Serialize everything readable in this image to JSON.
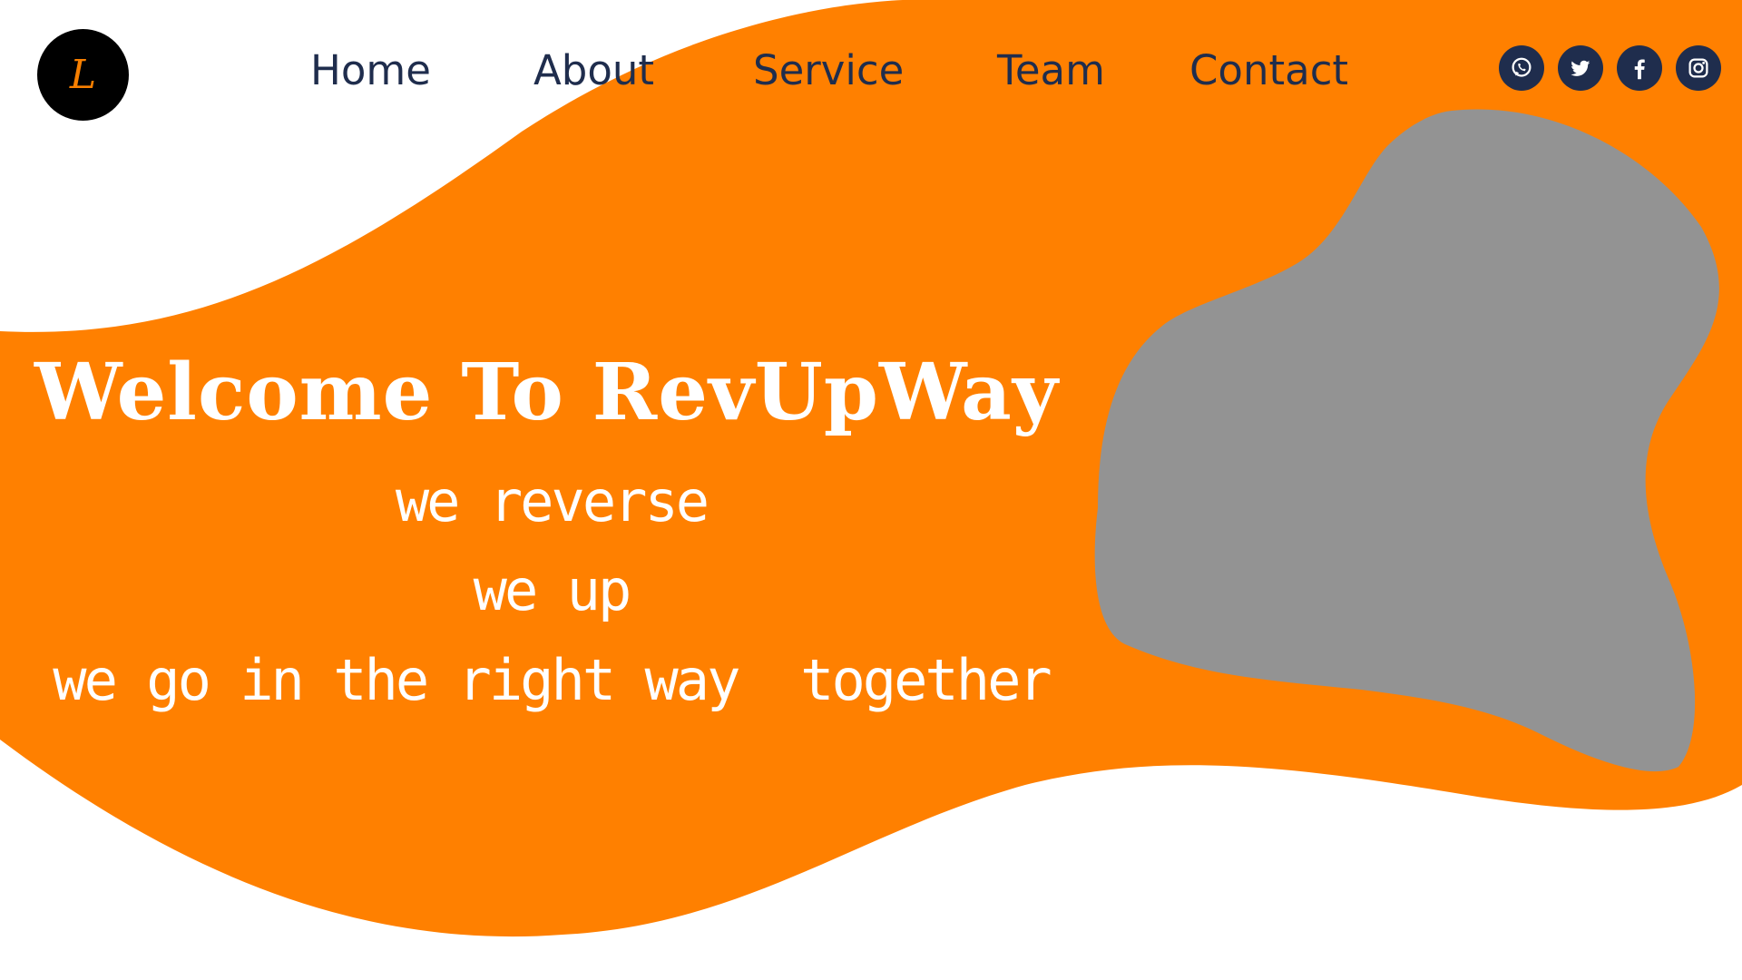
{
  "brand": {
    "logo_letter": "L"
  },
  "nav": {
    "items": [
      {
        "label": "Home"
      },
      {
        "label": "About"
      },
      {
        "label": "Service"
      },
      {
        "label": "Team"
      },
      {
        "label": "Contact"
      }
    ]
  },
  "social": {
    "icons": [
      "whatsapp-icon",
      "twitter-icon",
      "facebook-icon",
      "instagram-icon"
    ]
  },
  "hero": {
    "title": "Welcome To RevUpWay",
    "lines": [
      "we reverse",
      "we up",
      "we go in the right way  together"
    ]
  },
  "colors": {
    "accent": "#ff8000",
    "blob": "#939393",
    "nav_text": "#1f2d4d",
    "logo_bg": "#000000"
  }
}
